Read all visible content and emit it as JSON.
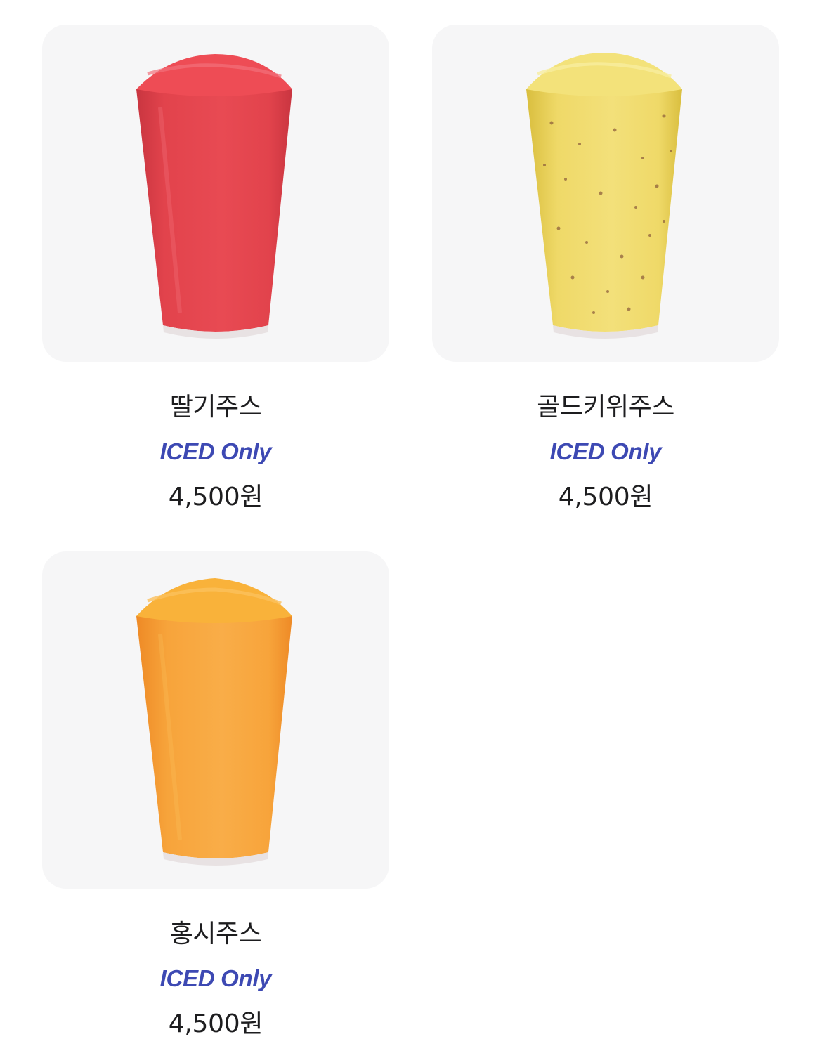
{
  "menu": {
    "items": [
      {
        "name": "딸기주스",
        "badge": "ICED Only",
        "price": "4,500원",
        "image_icon": "strawberry-juice-cup-icon",
        "colors": {
          "top": "#ee4c55",
          "body": "#e2434c",
          "shade": "#c93540",
          "highlight": "#f2707a"
        }
      },
      {
        "name": "골드키위주스",
        "badge": "ICED Only",
        "price": "4,500원",
        "image_icon": "gold-kiwi-juice-cup-icon",
        "colors": {
          "top": "#f3e27a",
          "body": "#efd968",
          "shade": "#d9be3e",
          "highlight": "#f8ee9f"
        }
      },
      {
        "name": "홍시주스",
        "badge": "ICED Only",
        "price": "4,500원",
        "image_icon": "persimmon-juice-cup-icon",
        "colors": {
          "top": "#f9b23a",
          "body": "#f7a43b",
          "shade": "#ee8a26",
          "highlight": "#fbc15c"
        }
      }
    ],
    "colors": {
      "card_background": "#f6f6f7",
      "badge_text": "#3d49b3",
      "text": "#1d1d1f"
    }
  }
}
